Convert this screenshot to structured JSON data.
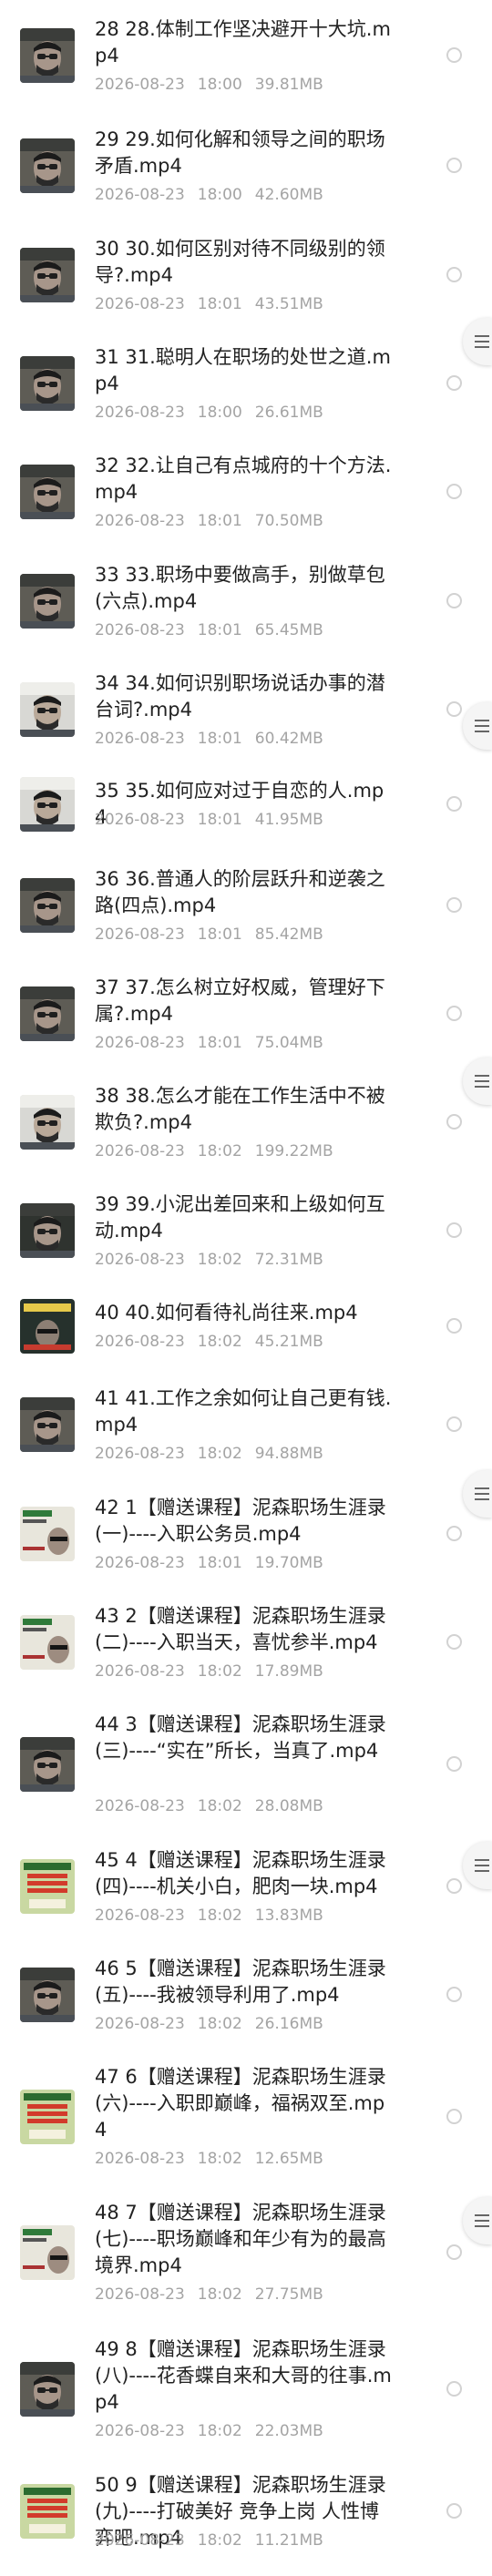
{
  "files": [
    {
      "title": "28 28.体制工作坚决避开十大坑.mp4",
      "date": "2026-08-23",
      "time": "18:00",
      "size": "39.81MB",
      "thumb": "face"
    },
    {
      "title": "29 29.如何化解和领导之间的职场矛盾.mp4",
      "date": "2026-08-23",
      "time": "18:00",
      "size": "42.60MB",
      "thumb": "face"
    },
    {
      "title": "30 30.如何区别对待不同级别的领导?.mp4",
      "date": "2026-08-23",
      "time": "18:01",
      "size": "43.51MB",
      "thumb": "face"
    },
    {
      "title": "31 31.聪明人在职场的处世之道.mp4",
      "date": "2026-08-23",
      "time": "18:00",
      "size": "26.61MB",
      "thumb": "face"
    },
    {
      "title": "32 32.让自己有点城府的十个方法.mp4",
      "date": "2026-08-23",
      "time": "18:01",
      "size": "70.50MB",
      "thumb": "face"
    },
    {
      "title": "33 33.职场中要做高手，别做草包(六点).mp4",
      "date": "2026-08-23",
      "time": "18:01",
      "size": "65.45MB",
      "thumb": "face"
    },
    {
      "title": "34 34.如何识别职场说话办事的潜台词?.mp4",
      "date": "2026-08-23",
      "time": "18:01",
      "size": "60.42MB",
      "thumb": "face-light"
    },
    {
      "title": "35 35.如何应对过于自恋的人.mp4",
      "date": "2026-08-23",
      "time": "18:01",
      "size": "41.95MB",
      "thumb": "face-light"
    },
    {
      "title": "36 36.普通人的阶层跃升和逆袭之路(四点).mp4",
      "date": "2026-08-23",
      "time": "18:01",
      "size": "85.42MB",
      "thumb": "face"
    },
    {
      "title": "37 37.怎么树立好权威，管理好下属?.mp4",
      "date": "2026-08-23",
      "time": "18:01",
      "size": "75.04MB",
      "thumb": "face"
    },
    {
      "title": "38 38.怎么才能在工作生活中不被欺负?.mp4",
      "date": "2026-08-23",
      "time": "18:02",
      "size": "199.22MB",
      "thumb": "face-light"
    },
    {
      "title": "39 39.小泥出差回来和上级如何互动.mp4",
      "date": "2026-08-23",
      "time": "18:02",
      "size": "72.31MB",
      "thumb": "face-dark"
    },
    {
      "title": "40 40.如何看待礼尚往来.mp4",
      "date": "2026-08-23",
      "time": "18:02",
      "size": "45.21MB",
      "thumb": "poster-dark"
    },
    {
      "title": "41 41.工作之余如何让自己更有钱.mp4",
      "date": "2026-08-23",
      "time": "18:02",
      "size": "94.88MB",
      "thumb": "face"
    },
    {
      "title": "42 1【赠送课程】泥森职场生涯录(一)----入职公务员.mp4",
      "date": "2026-08-23",
      "time": "18:01",
      "size": "19.70MB",
      "thumb": "poster-text"
    },
    {
      "title": "43 2【赠送课程】泥森职场生涯录(二)----入职当天，喜忧参半.mp4",
      "date": "2026-08-23",
      "time": "18:02",
      "size": "17.89MB",
      "thumb": "poster-text"
    },
    {
      "title": "44 3【赠送课程】泥森职场生涯录(三)----“实在”所长，当真了.mp4",
      "date": "2026-08-23",
      "time": "18:02",
      "size": "28.08MB",
      "thumb": "face"
    },
    {
      "title": "45 4【赠送课程】泥森职场生涯录(四)----机关小白，肥肉一块.mp4",
      "date": "2026-08-23",
      "time": "18:02",
      "size": "13.83MB",
      "thumb": "poster-green"
    },
    {
      "title": "46 5【赠送课程】泥森职场生涯录(五)----我被领导利用了.mp4",
      "date": "2026-08-23",
      "time": "18:02",
      "size": "26.16MB",
      "thumb": "face"
    },
    {
      "title": "47 6【赠送课程】泥森职场生涯录(六)----入职即巅峰，福祸双至.mp4",
      "date": "2026-08-23",
      "time": "18:02",
      "size": "12.65MB",
      "thumb": "poster-green"
    },
    {
      "title": "48 7【赠送课程】泥森职场生涯录(七)----职场巅峰和年少有为的最高境界.mp4",
      "date": "2026-08-23",
      "time": "18:02",
      "size": "27.75MB",
      "thumb": "poster-text"
    },
    {
      "title": "49 8【赠送课程】泥森职场生涯录(八)----花香蝶自来和大哥的往事.mp4",
      "date": "2026-08-23",
      "time": "18:02",
      "size": "22.03MB",
      "thumb": "face"
    },
    {
      "title": "50 9【赠送课程】泥森职场生涯录(九)----打破美好 竞争上岗 人性博弈吧.mp4",
      "date": "2026-08-23",
      "time": "18:02",
      "size": "11.21MB",
      "thumb": "poster-green"
    }
  ],
  "icons": {
    "radio": "radio-unchecked-icon",
    "drag_handle": "drag-handle-icon"
  },
  "colors": {
    "title_text": "#222222",
    "meta_text": "#a4a4a4",
    "radio_border": "#d2d2d2"
  }
}
